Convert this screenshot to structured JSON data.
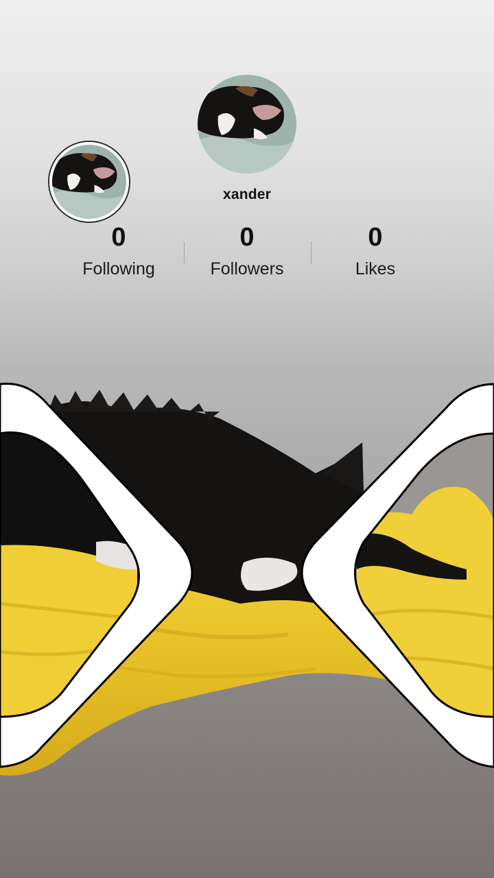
{
  "profile": {
    "username": "xander",
    "avatar_icon": "cat-avatar-icon"
  },
  "stats": [
    {
      "value": "0",
      "label": "Following"
    },
    {
      "value": "0",
      "label": "Followers"
    },
    {
      "value": "0",
      "label": "Likes"
    }
  ],
  "colors": {
    "blanket": "#f2d23a",
    "frame_fill": "#ffffff",
    "frame_outline": "#000000"
  }
}
